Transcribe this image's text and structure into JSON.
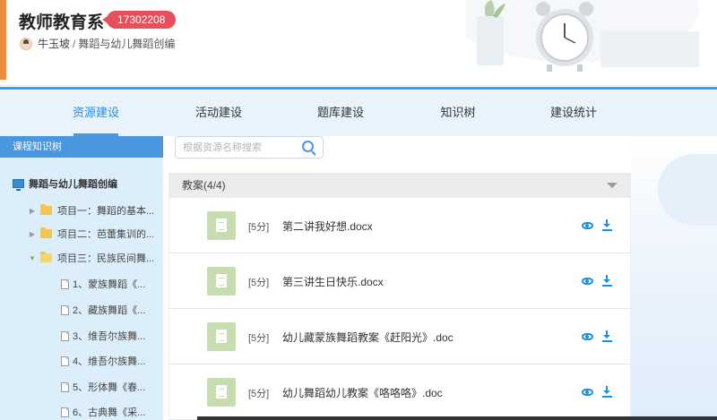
{
  "header": {
    "title": "教师教育系",
    "code": "17302208",
    "teacher": "牛玉坡",
    "separator": "/",
    "course": "舞蹈与幼儿舞蹈创编"
  },
  "nav": {
    "tabs": [
      {
        "label": "资源建设",
        "active": true
      },
      {
        "label": "活动建设",
        "active": false
      },
      {
        "label": "题库建设",
        "active": false
      },
      {
        "label": "知识树",
        "active": false
      },
      {
        "label": "建设统计",
        "active": false
      }
    ]
  },
  "tree": {
    "heading": "课程知识树",
    "root": "舞蹈与幼儿舞蹈创编",
    "items": [
      {
        "label": "项目一：舞蹈的基本...",
        "type": "folder",
        "expanded": false
      },
      {
        "label": "项目二：芭蕾集训的...",
        "type": "folder",
        "expanded": false
      },
      {
        "label": "项目三：民族民间舞...",
        "type": "folder",
        "expanded": true
      },
      {
        "label": "1、蒙族舞蹈《...",
        "type": "doc"
      },
      {
        "label": "2、藏族舞蹈《...",
        "type": "doc"
      },
      {
        "label": "3、维吾尔族舞...",
        "type": "doc"
      },
      {
        "label": "4、维吾尔族舞...",
        "type": "doc"
      },
      {
        "label": "5、形体舞《春...",
        "type": "doc"
      },
      {
        "label": "6、古典舞《采...",
        "type": "doc"
      }
    ]
  },
  "search": {
    "placeholder": "根据资源名称搜索",
    "value": ""
  },
  "section": {
    "title": "教案(4/4)"
  },
  "files": [
    {
      "score": "[5分]",
      "name": "第二讲我好想.docx"
    },
    {
      "score": "[5分]",
      "name": "第三讲生日快乐.docx"
    },
    {
      "score": "[5分]",
      "name": "幼儿藏蒙族舞蹈教案《赶阳光》.doc"
    },
    {
      "score": "[5分]",
      "name": "幼儿舞蹈幼儿教案《咯咯咯》.doc"
    }
  ],
  "colors": {
    "accent": "#3f9be8",
    "badge": "#e6505a",
    "header_bar": "#f08a3c",
    "icon_action": "#1f8fe0"
  }
}
